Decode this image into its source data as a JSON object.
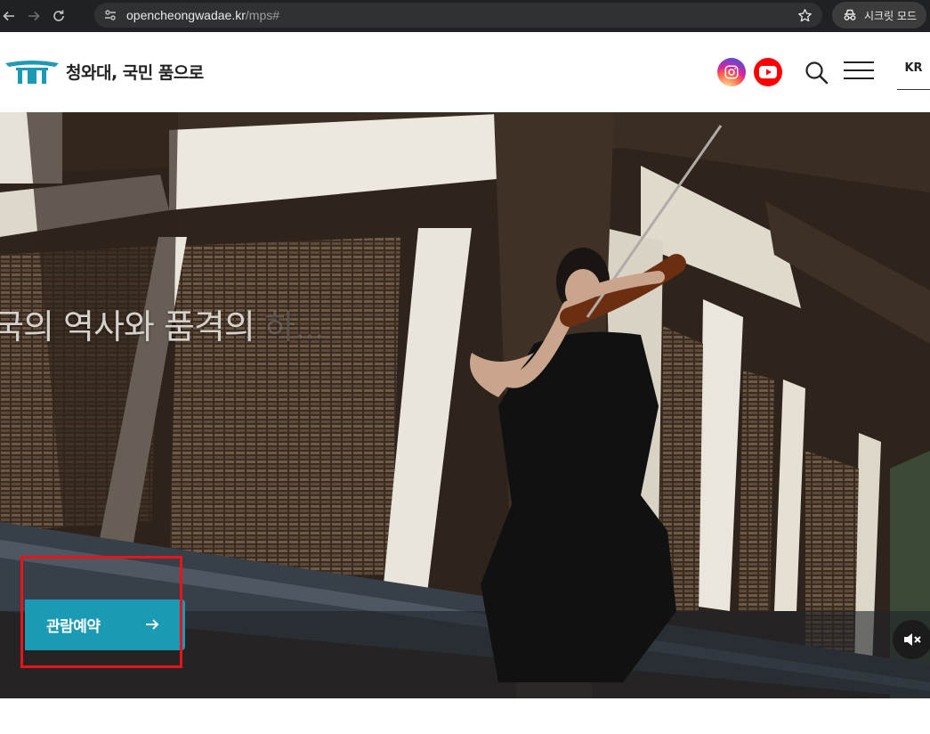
{
  "browser": {
    "url_host": "opencheongwadae.kr",
    "url_path": "/mps#",
    "incognito_label": "시크릿 모드"
  },
  "header": {
    "logo_text": "청와대, 국민 품으로",
    "lang": "KR"
  },
  "hero": {
    "caption_main": "국의 역사와 품격의",
    "caption_fade": "하...",
    "cta_label": "관람예약"
  },
  "colors": {
    "brand_teal": "#1a9ab5",
    "highlight_red": "#e8141a",
    "youtube_red": "#ff0000"
  },
  "icons": [
    "back-icon",
    "forward-icon",
    "reload-icon",
    "site-info-icon",
    "star-icon",
    "incognito-icon",
    "instagram-icon",
    "youtube-icon",
    "search-icon",
    "hamburger-menu-icon",
    "arrow-right-icon",
    "mute-icon"
  ]
}
